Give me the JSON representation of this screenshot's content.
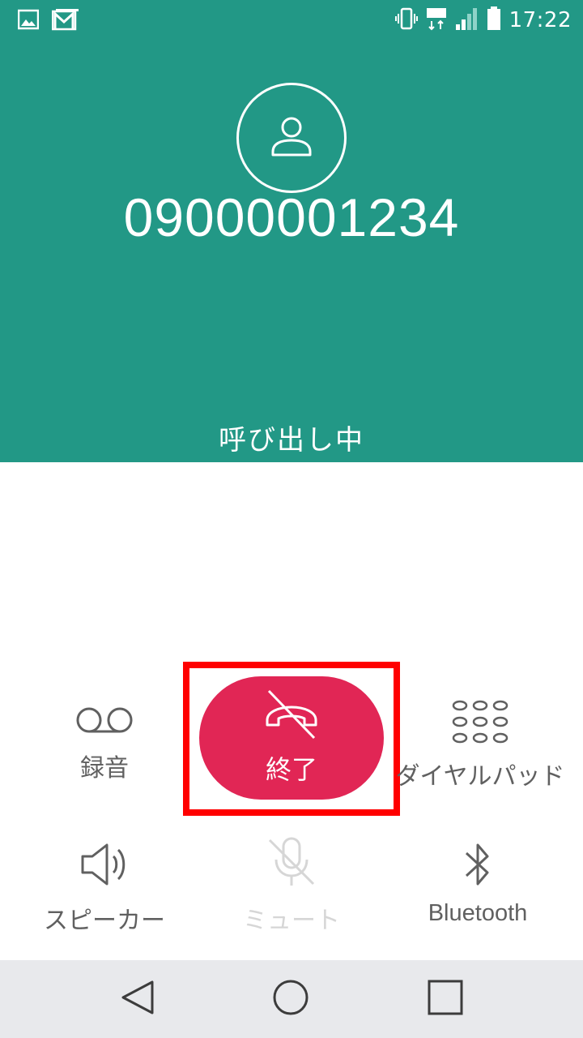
{
  "statusbar": {
    "time": "17:22",
    "network": "LTE",
    "icons": [
      "image-notification-icon",
      "gmail-icon",
      "vibrate-icon",
      "lte-icon",
      "signal-icon",
      "battery-icon"
    ]
  },
  "call": {
    "number": "09000001234",
    "status": "呼び出し中"
  },
  "controls": {
    "record_label": "録音",
    "end_label": "終了",
    "dialpad_label": "ダイヤルパッド",
    "speaker_label": "スピーカー",
    "mute_label": "ミュート",
    "bluetooth_label": "Bluetooth"
  },
  "colors": {
    "header": "#229886",
    "end_button": "#e12655",
    "highlight": "#ff0000"
  }
}
